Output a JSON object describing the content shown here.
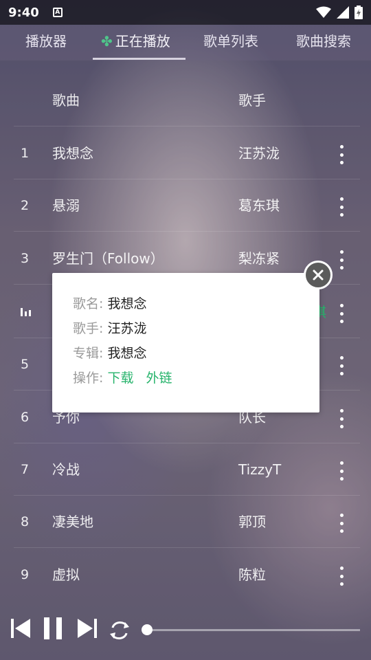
{
  "status_bar": {
    "time": "9:40",
    "notification_icon_label": "A",
    "icons": [
      "wifi-icon",
      "signal-icon",
      "battery-icon"
    ]
  },
  "tabs": [
    {
      "label": "播放器",
      "active": false
    },
    {
      "label": "正在播放",
      "active": true,
      "icon": "clover-icon"
    },
    {
      "label": "歌单列表",
      "active": false
    },
    {
      "label": "歌曲搜索",
      "active": false
    }
  ],
  "list": {
    "header": {
      "song": "歌曲",
      "artist": "歌手"
    },
    "rows": [
      {
        "num": "1",
        "song": "我想念",
        "artist": "汪苏泷"
      },
      {
        "num": "2",
        "song": "悬溺",
        "artist": "葛东琪"
      },
      {
        "num": "3",
        "song": "罗生门（Follow）",
        "artist": "梨冻紧"
      },
      {
        "num": "",
        "song": "",
        "artist": "",
        "playing": true,
        "artist_partial": "琪"
      },
      {
        "num": "5",
        "song": "",
        "artist": ""
      },
      {
        "num": "6",
        "song": "予你",
        "artist": "队长"
      },
      {
        "num": "7",
        "song": "冷战",
        "artist": "TizzyT"
      },
      {
        "num": "8",
        "song": "凄美地",
        "artist": "郭顶"
      },
      {
        "num": "9",
        "song": "虚拟",
        "artist": "陈粒"
      }
    ]
  },
  "popup": {
    "song_label": "歌名:",
    "song_value": "我想念",
    "artist_label": "歌手:",
    "artist_value": "汪苏泷",
    "album_label": "专辑:",
    "album_value": "我想念",
    "action_label": "操作:",
    "action_download": "下载",
    "action_external": "外链"
  },
  "player": {
    "progress": 0.0,
    "repeat_mode": "loop"
  },
  "colors": {
    "accent": "#26b36b",
    "popup_bg": "#ffffff",
    "close_button": "#5b5b5b"
  }
}
